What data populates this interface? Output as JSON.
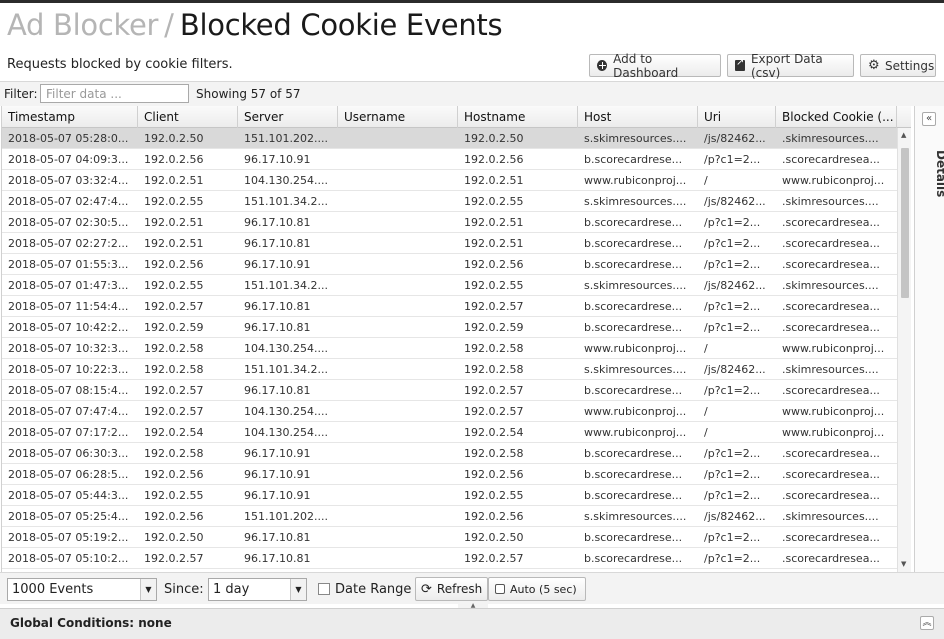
{
  "header": {
    "app_name": "Ad Blocker",
    "separator": "/",
    "title": "Blocked Cookie Events",
    "subtitle": "Requests blocked by cookie filters."
  },
  "toolbar": {
    "add_dashboard_label": "Add to Dashboard",
    "export_label": "Export Data (csv)",
    "settings_label": "Settings"
  },
  "filter": {
    "label": "Filter:",
    "placeholder": "Filter data ...",
    "value": "",
    "showing": "Showing 57 of 57"
  },
  "table": {
    "columns": [
      "Timestamp",
      "Client",
      "Server",
      "Username",
      "Hostname",
      "Host",
      "Uri",
      "Blocked Cookie (..."
    ],
    "rows": [
      [
        "2018-05-07 05:28:0...",
        "192.0.2.50",
        "151.101.202....",
        "",
        "192.0.2.50",
        "s.skimresources....",
        "/js/82462...",
        ".skimresources...."
      ],
      [
        "2018-05-07 04:09:3...",
        "192.0.2.56",
        "96.17.10.91",
        "",
        "192.0.2.56",
        "b.scorecardrese...",
        "/p?c1=2...",
        ".scorecardresea..."
      ],
      [
        "2018-05-07 03:32:4...",
        "192.0.2.51",
        "104.130.254....",
        "",
        "192.0.2.51",
        "www.rubiconproj...",
        "/",
        "www.rubiconproj..."
      ],
      [
        "2018-05-07 02:47:4...",
        "192.0.2.55",
        "151.101.34.2...",
        "",
        "192.0.2.55",
        "s.skimresources....",
        "/js/82462...",
        ".skimresources...."
      ],
      [
        "2018-05-07 02:30:5...",
        "192.0.2.51",
        "96.17.10.81",
        "",
        "192.0.2.51",
        "b.scorecardrese...",
        "/p?c1=2...",
        ".scorecardresea..."
      ],
      [
        "2018-05-07 02:27:2...",
        "192.0.2.51",
        "96.17.10.81",
        "",
        "192.0.2.51",
        "b.scorecardrese...",
        "/p?c1=2...",
        ".scorecardresea..."
      ],
      [
        "2018-05-07 01:55:3...",
        "192.0.2.56",
        "96.17.10.91",
        "",
        "192.0.2.56",
        "b.scorecardrese...",
        "/p?c1=2...",
        ".scorecardresea..."
      ],
      [
        "2018-05-07 01:47:3...",
        "192.0.2.55",
        "151.101.34.2...",
        "",
        "192.0.2.55",
        "s.skimresources....",
        "/js/82462...",
        ".skimresources...."
      ],
      [
        "2018-05-07 11:54:4...",
        "192.0.2.57",
        "96.17.10.81",
        "",
        "192.0.2.57",
        "b.scorecardrese...",
        "/p?c1=2...",
        ".scorecardresea..."
      ],
      [
        "2018-05-07 10:42:2...",
        "192.0.2.59",
        "96.17.10.81",
        "",
        "192.0.2.59",
        "b.scorecardrese...",
        "/p?c1=2...",
        ".scorecardresea..."
      ],
      [
        "2018-05-07 10:32:3...",
        "192.0.2.58",
        "104.130.254....",
        "",
        "192.0.2.58",
        "www.rubiconproj...",
        "/",
        "www.rubiconproj..."
      ],
      [
        "2018-05-07 10:22:3...",
        "192.0.2.58",
        "151.101.34.2...",
        "",
        "192.0.2.58",
        "s.skimresources....",
        "/js/82462...",
        ".skimresources...."
      ],
      [
        "2018-05-07 08:15:4...",
        "192.0.2.57",
        "96.17.10.81",
        "",
        "192.0.2.57",
        "b.scorecardrese...",
        "/p?c1=2...",
        ".scorecardresea..."
      ],
      [
        "2018-05-07 07:47:4...",
        "192.0.2.57",
        "104.130.254....",
        "",
        "192.0.2.57",
        "www.rubiconproj...",
        "/",
        "www.rubiconproj..."
      ],
      [
        "2018-05-07 07:17:2...",
        "192.0.2.54",
        "104.130.254....",
        "",
        "192.0.2.54",
        "www.rubiconproj...",
        "/",
        "www.rubiconproj..."
      ],
      [
        "2018-05-07 06:30:3...",
        "192.0.2.58",
        "96.17.10.91",
        "",
        "192.0.2.58",
        "b.scorecardrese...",
        "/p?c1=2...",
        ".scorecardresea..."
      ],
      [
        "2018-05-07 06:28:5...",
        "192.0.2.56",
        "96.17.10.91",
        "",
        "192.0.2.56",
        "b.scorecardrese...",
        "/p?c1=2...",
        ".scorecardresea..."
      ],
      [
        "2018-05-07 05:44:3...",
        "192.0.2.55",
        "96.17.10.91",
        "",
        "192.0.2.55",
        "b.scorecardrese...",
        "/p?c1=2...",
        ".scorecardresea..."
      ],
      [
        "2018-05-07 05:25:4...",
        "192.0.2.56",
        "151.101.202....",
        "",
        "192.0.2.56",
        "s.skimresources....",
        "/js/82462...",
        ".skimresources...."
      ],
      [
        "2018-05-07 05:19:2...",
        "192.0.2.50",
        "96.17.10.81",
        "",
        "192.0.2.50",
        "b.scorecardrese...",
        "/p?c1=2...",
        ".scorecardresea..."
      ],
      [
        "2018-05-07 05:10:2...",
        "192.0.2.57",
        "96.17.10.81",
        "",
        "192.0.2.57",
        "b.scorecardrese...",
        "/p?c1=2...",
        ".scorecardresea..."
      ]
    ]
  },
  "details": {
    "label": "Details"
  },
  "controls": {
    "events_select": "1000 Events",
    "since_label": "Since:",
    "since_select": "1 day",
    "date_range_label": "Date Range",
    "refresh_label": "Refresh",
    "auto_label": "Auto (5 sec)"
  },
  "global": {
    "label": "Global Conditions: none"
  },
  "icons": {
    "add": "plus-circle-icon",
    "export": "export-icon",
    "settings": "gear-icon",
    "refresh": "refresh-icon",
    "collapse": "chevron-double-icon"
  }
}
